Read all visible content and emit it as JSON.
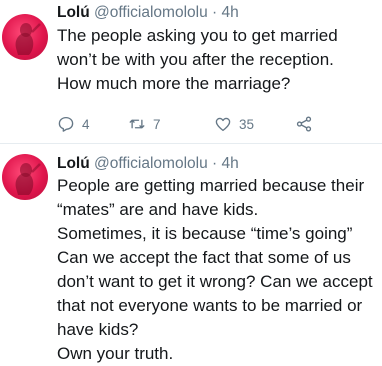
{
  "tweets": [
    {
      "name": "Lolú",
      "handle": "@officialomololu",
      "separator": "·",
      "time": "4h",
      "lines": [
        "The people asking you to get married",
        "won’t be with you after the reception.",
        "How much more the marriage?"
      ],
      "reply_count": "4",
      "retweet_count": "7",
      "like_count": "35",
      "icons": [
        "reply-icon",
        "retweet-icon",
        "like-icon",
        "share-icon"
      ]
    },
    {
      "name": "Lolú",
      "handle": "@officialomololu",
      "separator": "·",
      "time": "4h",
      "lines": [
        "People are getting married because their",
        "“mates” are and have kids.",
        "Sometimes, it is because “time’s going”",
        "Can we accept the fact that some of us",
        "don’t want to get it wrong? Can we accept",
        "that not everyone wants to be married or",
        "have kids?",
        "Own your truth."
      ]
    }
  ],
  "colors": {
    "text": "#14171a",
    "secondary": "#657786",
    "avatar": "#e0164d",
    "divider": "#e6ecf0"
  }
}
